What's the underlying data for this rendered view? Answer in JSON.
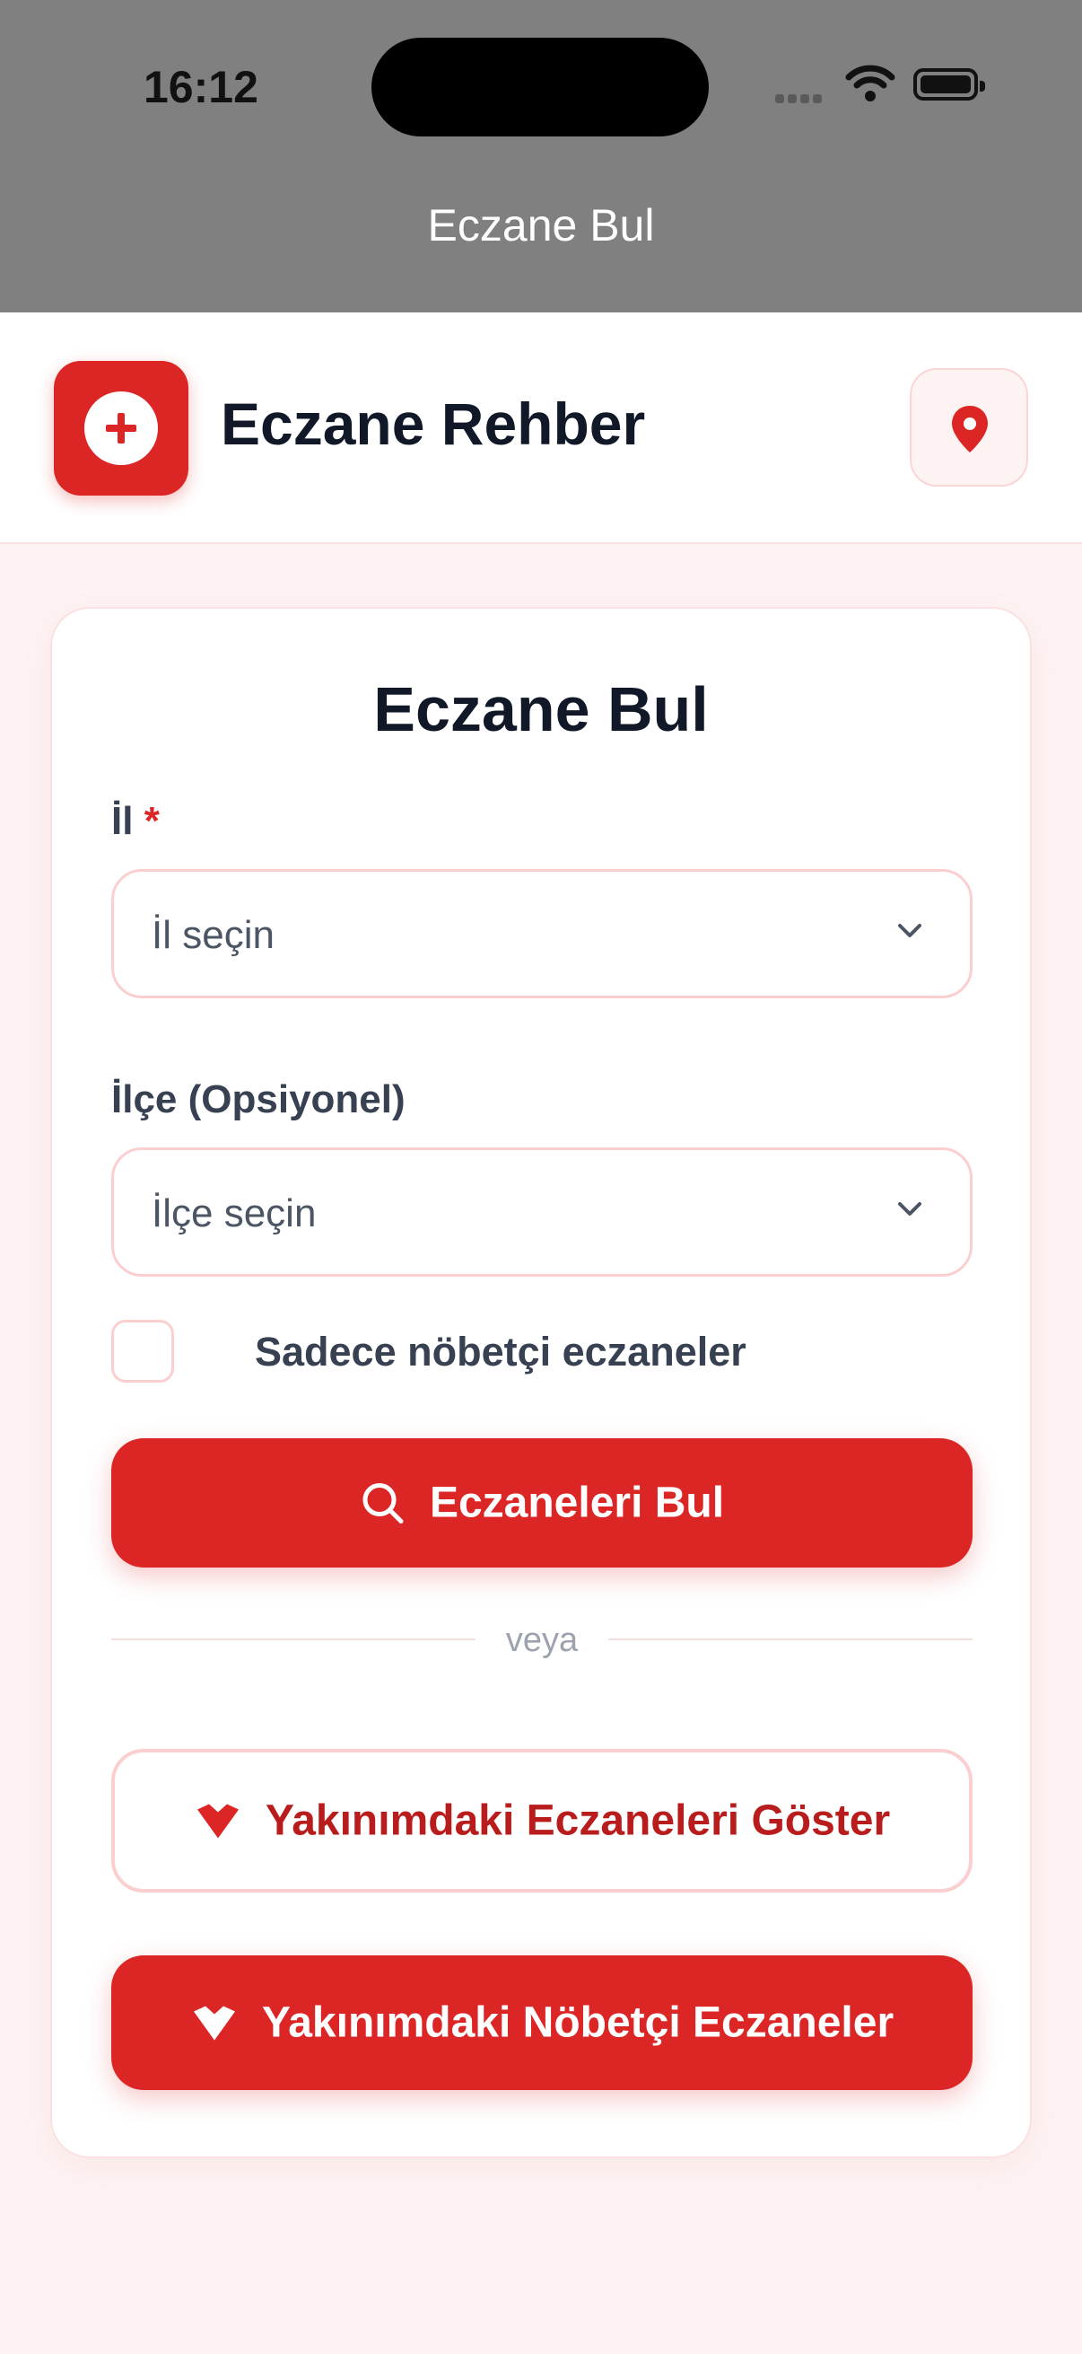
{
  "status_bar": {
    "time": "16:12"
  },
  "nav": {
    "title": "Eczane Bul"
  },
  "header": {
    "brand": "Eczane Rehber"
  },
  "form": {
    "title": "Eczane Bul",
    "province_label": "İl",
    "required_mark": "*",
    "province_placeholder": "İl seçin",
    "district_label": "İlçe (Opsiyonel)",
    "district_placeholder": "İlçe seçin",
    "on_duty_label": "Sadece nöbetçi eczaneler",
    "on_duty_checked": false,
    "search_button": "Eczaneleri Bul",
    "divider_text": "veya",
    "nearby_button": "Yakınımdaki Eczaneleri Göster",
    "nearby_on_duty_button": "Yakınımdaki Nöbetçi Eczaneler"
  },
  "colors": {
    "accent": "#dc2626",
    "accent_dark": "#b91c1c",
    "border": "#fbcfcf",
    "background": "#fdf3f3"
  },
  "icons": [
    "plus-circle-icon",
    "location-pin-icon",
    "chevron-down-icon",
    "search-icon",
    "navigation-arrow-icon"
  ]
}
